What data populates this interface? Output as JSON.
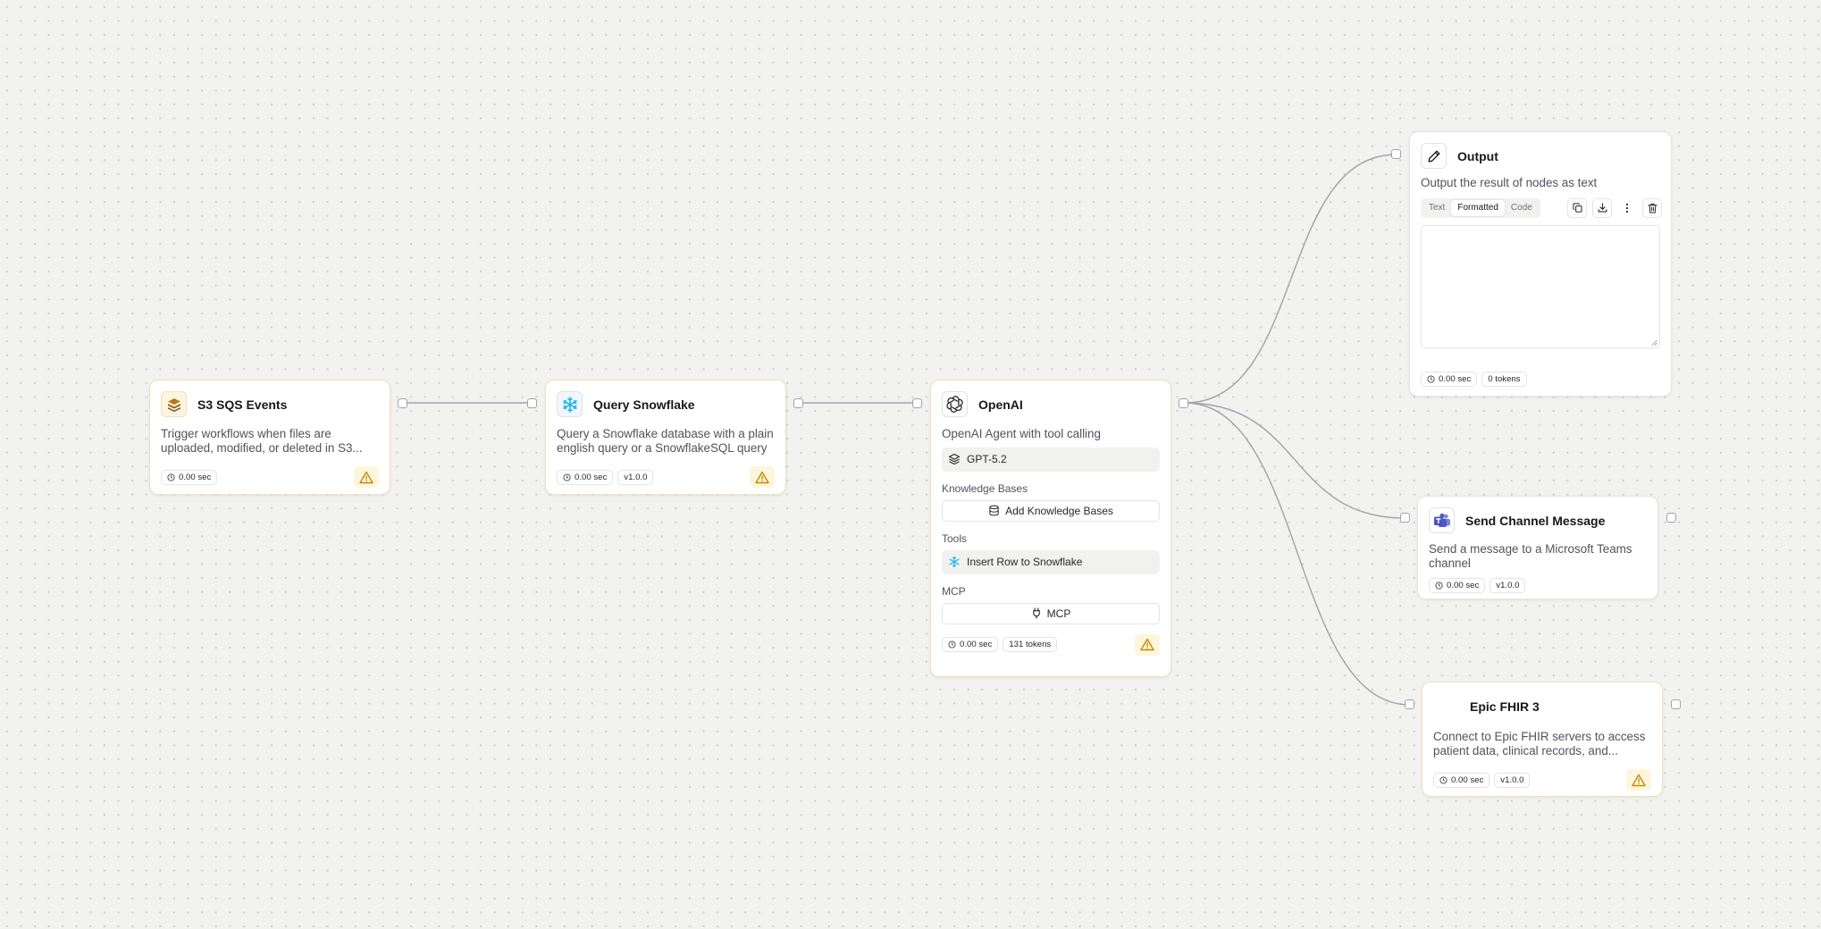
{
  "nodes": {
    "s3": {
      "title": "S3 SQS Events",
      "description": "Trigger workflows when files are uploaded, modified, or deleted in S3...",
      "time": "0.00 sec",
      "icon": "s3-sqs-icon"
    },
    "snowflake": {
      "title": "Query Snowflake",
      "description": "Query a Snowflake database with a plain english query or a SnowflakeSQL query",
      "time": "0.00 sec",
      "version": "v1.0.0",
      "icon": "snowflake-icon"
    },
    "openai": {
      "title": "OpenAI",
      "description": "OpenAI Agent with tool calling",
      "model": "GPT-5.2",
      "knowledge_label": "Knowledge Bases",
      "add_knowledge": "Add Knowledge Bases",
      "tools_label": "Tools",
      "tool_item": "Insert Row to Snowflake",
      "mcp_label": "MCP",
      "mcp_button": "MCP",
      "time": "0.00 sec",
      "tokens": "131 tokens",
      "icon": "openai-icon"
    },
    "output": {
      "title": "Output",
      "description": "Output the result of nodes as text",
      "tabs": [
        "Text",
        "Formatted",
        "Code"
      ],
      "active_tab": "Formatted",
      "time": "0.00 sec",
      "tokens": "0 tokens",
      "icon": "pencil-icon"
    },
    "teams": {
      "title": "Send Channel Message",
      "description": "Send a message to a Microsoft Teams channel",
      "time": "0.00 sec",
      "version": "v1.0.0",
      "icon": "teams-icon"
    },
    "epic": {
      "title": "Epic FHIR 3",
      "description": "Connect to Epic FHIR servers to access patient data, clinical records, and...",
      "time": "0.00 sec",
      "version": "v1.0.0"
    }
  },
  "colors": {
    "warning_border": "#efe1bd",
    "warning_bg": "#fdf6dc",
    "warning_icon": "#c48a04",
    "edge": "#a1a1aa",
    "canvas": "#f2f2f1"
  }
}
